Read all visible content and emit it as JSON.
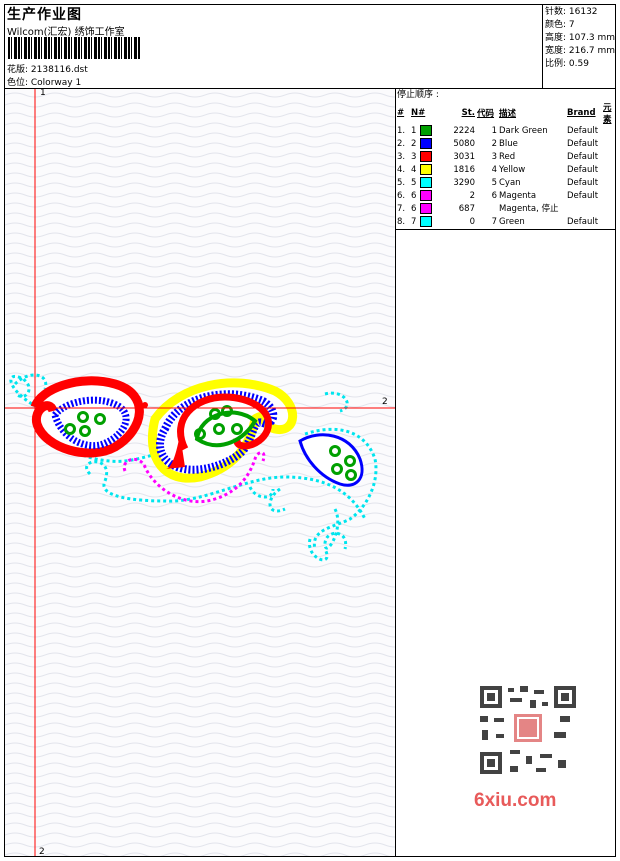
{
  "header": {
    "title": "生产作业图",
    "studio": "Wilcom(汇宏) 绣饰工作室",
    "design_label": "花版: 2138116.dst",
    "colorway_label": "色位: Colorway 1"
  },
  "stats": {
    "stitches": "针数: 16132",
    "colors": "颜色: 7",
    "height": "高度: 107.3 mm",
    "width": "宽度: 216.7 mm",
    "scale": "比例: 0.59"
  },
  "stop_sequence": {
    "title": "停止顺序 :",
    "headers": [
      "#",
      "N#",
      "St.",
      "代码",
      "描述",
      "Brand",
      "元素"
    ],
    "rows": [
      {
        "idx": "1.",
        "n": "1",
        "st": "2224",
        "code": "1",
        "desc": "Dark Green",
        "brand": "Default",
        "color": "#00a000"
      },
      {
        "idx": "2.",
        "n": "2",
        "st": "5080",
        "code": "2",
        "desc": "Blue",
        "brand": "Default",
        "color": "#0000ff"
      },
      {
        "idx": "3.",
        "n": "3",
        "st": "3031",
        "code": "3",
        "desc": "Red",
        "brand": "Default",
        "color": "#ff0000"
      },
      {
        "idx": "4.",
        "n": "4",
        "st": "1816",
        "code": "4",
        "desc": "Yellow",
        "brand": "Default",
        "color": "#ffff00"
      },
      {
        "idx": "5.",
        "n": "5",
        "st": "3290",
        "code": "5",
        "desc": "Cyan",
        "brand": "Default",
        "color": "#00ffff"
      },
      {
        "idx": "6.",
        "n": "6",
        "st": "2",
        "code": "6",
        "desc": "Magenta",
        "brand": "Default",
        "color": "#ff00ff"
      },
      {
        "idx": "7.",
        "n": "6",
        "st": "687",
        "code": "",
        "desc": "Magenta, 停止",
        "brand": "",
        "color": "#ff00ff"
      },
      {
        "idx": "8.",
        "n": "7",
        "st": "0",
        "code": "7",
        "desc": "Green",
        "brand": "Default",
        "color": "#00ffff"
      }
    ]
  },
  "canvas": {
    "axis_top": "1",
    "axis_right": "2",
    "axis_bottom": "2",
    "stitch_colors": {
      "red": "#ff0000",
      "blue": "#0000ff",
      "green": "#00a000",
      "yellow": "#ffff00",
      "cyan": "#00ffff",
      "magenta": "#ff00ff"
    }
  },
  "watermark": {
    "site": "6xiu.com",
    "qr_icon": "qr-code-icon"
  }
}
